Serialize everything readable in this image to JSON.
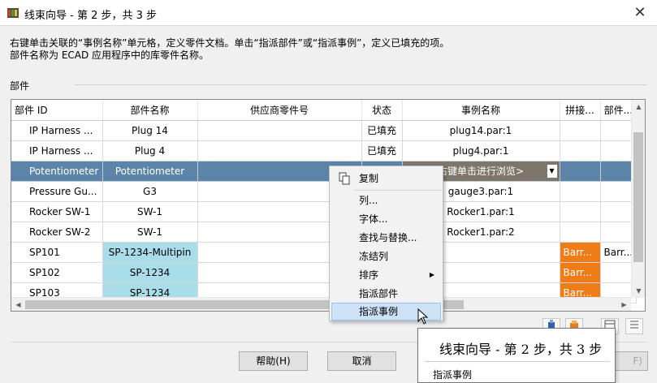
{
  "window": {
    "title": "线束向导 - 第 2 步，共 3 步",
    "close_glyph": "✕"
  },
  "description": {
    "line1": "右键单击关联的“事例名称”单元格，定义零件文档。单击“指派部件”或“指派事例”，定义已填充的项。",
    "line2": "部件名称为 ECAD 应用程序中的库零件名称。"
  },
  "group_label": "部件",
  "grid": {
    "columns": [
      "部件 ID",
      "部件名称",
      "供应商零件号",
      "状态",
      "事例名称",
      "拼接...",
      "部件..."
    ],
    "rows": [
      {
        "id": "IP Harness ...",
        "name": "Plug 14",
        "vendor": "",
        "status": "已填充",
        "instance": "plug14.par:1",
        "splice": "",
        "part": ""
      },
      {
        "id": "IP Harness ...",
        "name": "Plug 4",
        "vendor": "",
        "status": "已填充",
        "instance": "plug4.par:1",
        "splice": "",
        "part": ""
      },
      {
        "id": "Potentiometer",
        "name": "Potentiometer",
        "vendor": "",
        "status": "",
        "instance": "右键单击进行浏览>",
        "splice": "",
        "part": ""
      },
      {
        "id": "Pressure Gu...",
        "name": "G3",
        "vendor": "",
        "status": "",
        "instance": "gauge3.par:1",
        "splice": "",
        "part": ""
      },
      {
        "id": "Rocker SW-1",
        "name": "SW-1",
        "vendor": "",
        "status": "",
        "instance": "Rocker1.par:1",
        "splice": "",
        "part": ""
      },
      {
        "id": "Rocker SW-2",
        "name": "SW-1",
        "vendor": "",
        "status": "",
        "instance": "Rocker1.par:2",
        "splice": "",
        "part": ""
      },
      {
        "id": "SP101",
        "name": "SP-1234-Multipin",
        "vendor": "",
        "status": "",
        "instance": "",
        "splice": "Barr...",
        "part": "Barr..."
      },
      {
        "id": "SP102",
        "name": "SP-1234",
        "vendor": "",
        "status": "",
        "instance": "",
        "splice": "Barr...",
        "part": ""
      },
      {
        "id": "SP103",
        "name": "SP-1234",
        "vendor": "",
        "status": "",
        "instance": "",
        "splice": "Barr...",
        "part": ""
      }
    ],
    "selected_row_index": 2,
    "colors": {
      "selected": "#5b84a8",
      "cyan": "#a9dde9",
      "orange": "#f07c17"
    }
  },
  "context_menu": {
    "items": [
      "复制",
      "列...",
      "字体...",
      "查找与替换...",
      "冻结列",
      "排序",
      "指派部件",
      "指派事例"
    ],
    "hovered": "指派事例"
  },
  "buttons": {
    "help": "帮助(H)",
    "cancel": "取消",
    "next_partial": "F)"
  },
  "tooltip": {
    "title": "线束向导 - 第 2 步，共 3 步",
    "body": "指派事例"
  }
}
